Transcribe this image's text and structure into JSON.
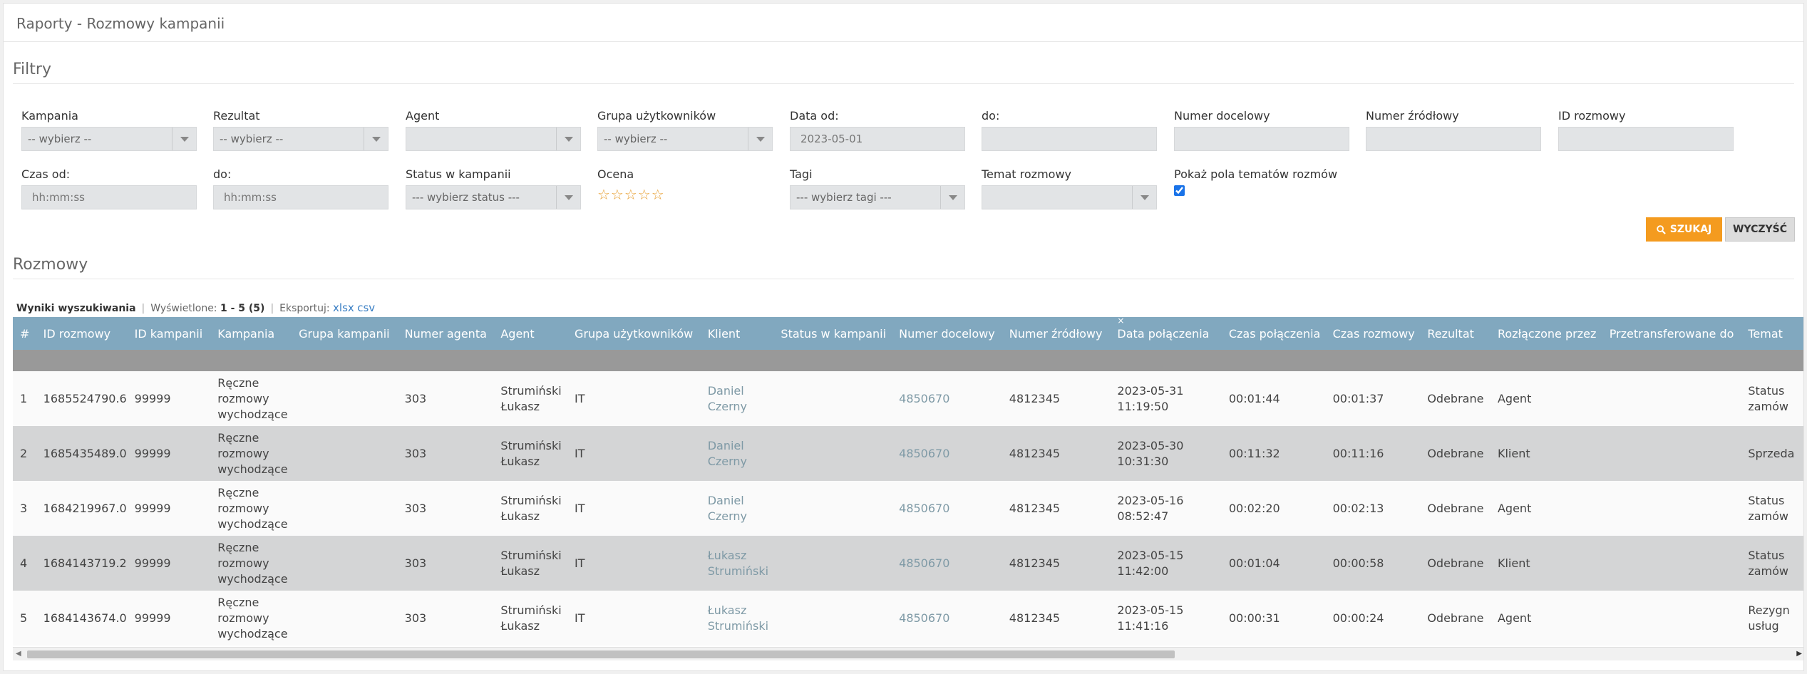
{
  "page_title": "Raporty - Rozmowy kampanii",
  "filters": {
    "section_title": "Filtry",
    "kampania": {
      "label": "Kampania",
      "value": "-- wybierz --"
    },
    "rezultat": {
      "label": "Rezultat",
      "value": "-- wybierz --"
    },
    "agent": {
      "label": "Agent",
      "value": ""
    },
    "grupa": {
      "label": "Grupa użytkowników",
      "value": "-- wybierz --"
    },
    "data_od": {
      "label": "Data od:",
      "value": "2023-05-01"
    },
    "data_do": {
      "label": "do:",
      "value": ""
    },
    "numer_docelowy": {
      "label": "Numer docelowy",
      "value": ""
    },
    "numer_zrodlowy": {
      "label": "Numer źródłowy",
      "value": ""
    },
    "id_rozmowy": {
      "label": "ID rozmowy",
      "value": ""
    },
    "czas_od": {
      "label": "Czas od:",
      "placeholder": "hh:mm:ss"
    },
    "czas_do": {
      "label": "do:",
      "placeholder": "hh:mm:ss"
    },
    "status": {
      "label": "Status w kampanii",
      "value": "--- wybierz status ---"
    },
    "ocena": {
      "label": "Ocena",
      "stars": "☆☆☆☆☆",
      "rating": 0
    },
    "tagi": {
      "label": "Tagi",
      "value": "--- wybierz tagi ---"
    },
    "temat": {
      "label": "Temat rozmowy",
      "value": ""
    },
    "pokaz": {
      "label": "Pokaż pola tematów rozmów",
      "checked": true
    },
    "search_button": "SZUKAJ",
    "clear_button": "WYCZYŚĆ"
  },
  "results": {
    "section_title": "Rozmowy",
    "heading": "Wyniki wyszukiwania",
    "displayed_label": "Wyświetlone:",
    "displayed_value": "1 - 5 (5)",
    "export_label": "Eksportuj:",
    "export_xlsx": "xlsx",
    "export_csv": "csv"
  },
  "table": {
    "columns": [
      "#",
      "ID rozmowy",
      "ID kampanii",
      "Kampania",
      "Grupa kampanii",
      "Numer agenta",
      "Agent",
      "Grupa użytkowników",
      "Klient",
      "Status w kampanii",
      "Numer docelowy",
      "Numer źródłowy",
      "Data połączenia",
      "Czas połączenia",
      "Czas rozmowy",
      "Rezultat",
      "Rozłączone przez",
      "Przetransferowane do",
      "Temat"
    ],
    "rows": [
      [
        "1",
        "1685524790.6",
        "99999",
        "Ręczne rozmowy wychodzące",
        "",
        "303",
        "Strumiński Łukasz",
        "IT",
        "Daniel Czerny",
        "",
        "4850670",
        "4812345",
        "2023-05-31 11:19:50",
        "00:01:44",
        "00:01:37",
        "Odebrane",
        "Agent",
        "",
        "Status zamów"
      ],
      [
        "2",
        "1685435489.0",
        "99999",
        "Ręczne rozmowy wychodzące",
        "",
        "303",
        "Strumiński Łukasz",
        "IT",
        "Daniel Czerny",
        "",
        "4850670",
        "4812345",
        "2023-05-30 10:31:30",
        "00:11:32",
        "00:11:16",
        "Odebrane",
        "Klient",
        "",
        "Sprzeda"
      ],
      [
        "3",
        "1684219967.0",
        "99999",
        "Ręczne rozmowy wychodzące",
        "",
        "303",
        "Strumiński Łukasz",
        "IT",
        "Daniel Czerny",
        "",
        "4850670",
        "4812345",
        "2023-05-16 08:52:47",
        "00:02:20",
        "00:02:13",
        "Odebrane",
        "Agent",
        "",
        "Status zamów"
      ],
      [
        "4",
        "1684143719.2",
        "99999",
        "Ręczne rozmowy wychodzące",
        "",
        "303",
        "Strumiński Łukasz",
        "IT",
        "Łukasz Strumiński",
        "",
        "4850670",
        "4812345",
        "2023-05-15 11:42:00",
        "00:01:04",
        "00:00:58",
        "Odebrane",
        "Klient",
        "",
        "Status zamów"
      ],
      [
        "5",
        "1684143674.0",
        "99999",
        "Ręczne rozmowy wychodzące",
        "",
        "303",
        "Strumiński Łukasz",
        "IT",
        "Łukasz Strumiński",
        "",
        "4850670",
        "4812345",
        "2023-05-15 11:41:16",
        "00:00:31",
        "00:00:24",
        "Odebrane",
        "Agent",
        "",
        "Rezygn usług"
      ]
    ]
  }
}
